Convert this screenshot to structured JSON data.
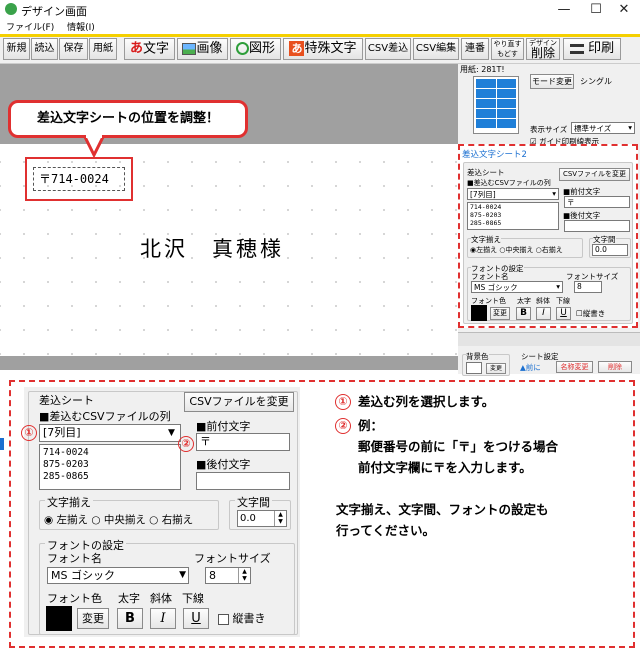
{
  "window": {
    "title": "デザイン画面",
    "minimize": "—",
    "maximize": "☐",
    "close": "✕"
  },
  "menu": [
    "ファイル(F)",
    "情報(I)"
  ],
  "toolbar": {
    "new": "新規",
    "open": "読込",
    "save": "保存",
    "paper": "用紙",
    "text": "文字",
    "image": "画像",
    "shape": "図形",
    "special_text": "特殊文字",
    "csv_insert": "CSV差込",
    "csv_edit": "CSV編集",
    "serial": "連番",
    "redo": "やり直す",
    "undo": "もどす",
    "design_delete_top": "デザイン",
    "design_delete": "削除",
    "print": "印刷"
  },
  "callout": "差込文字シートの位置を調整！",
  "canvas": {
    "zip": "〒714-0024",
    "name": "北沢　真穂様"
  },
  "right": {
    "paper_info": "用紙: 281T!",
    "mode_button": "モード変更",
    "mode_value": "シングル",
    "display_size_label": "表示サイズ",
    "display_size_value": "標準サイズ",
    "guide_checkbox": "ガイド印刷線表示",
    "sheet_title": "差込文字シート2",
    "sheet_label": "差込シート",
    "csv_file_button": "CSVファイルを変更",
    "column_label": "■差込むCSVファイルの列",
    "column_value": "[7列目]",
    "prefix_label": "■前付文字",
    "prefix_value": "〒",
    "suffix_label": "■後付文字",
    "list": [
      "714-0024",
      "875-0203",
      "285-0865"
    ],
    "align_label": "文字揃え",
    "align_left": "左揃え",
    "align_center": "中央揃え",
    "align_right": "右揃え",
    "spacing_label": "文字間",
    "spacing_value": "0.0",
    "font_settings": "フォントの設定",
    "font_name_label": "フォント名",
    "font_name_value": "MS ゴシック",
    "font_size_label": "フォントサイズ",
    "font_size_value": "8",
    "font_color_label": "フォント色",
    "bold_label": "太字",
    "italic_label": "斜体",
    "underline_label": "下線",
    "change_button": "変更",
    "bold_btn": "B",
    "italic_btn": "I",
    "underline_btn": "U",
    "vertical_label": "縦書き",
    "bg_label": "背景色",
    "bg_change": "変更",
    "sheet_settings": "シート設定",
    "prev": "▲前に",
    "rename": "名称変更",
    "delete": "削除"
  },
  "dialog": {
    "sheet_label": "差込シート",
    "csv_file_button": "CSVファイルを変更",
    "column_label": "■差込むCSVファイルの列",
    "column_value": "[7列目]",
    "prefix_label": "■前付文字",
    "prefix_value": "〒",
    "suffix_label": "■後付文字",
    "suffix_value": "",
    "list": [
      "714-0024",
      "875-0203",
      "285-0865"
    ],
    "align_label": "文字揃え",
    "align_left": "左揃え",
    "align_center": "中央揃え",
    "align_right": "右揃え",
    "spacing_label": "文字間",
    "spacing_value": "0.0",
    "font_settings": "フォントの設定",
    "font_name_label": "フォント名",
    "font_name_value": "MS ゴシック",
    "font_size_label": "フォントサイズ",
    "font_size_value": "8",
    "font_color_label": "フォント色",
    "bold_label": "太字",
    "italic_label": "斜体",
    "underline_label": "下線",
    "change_button": "変更",
    "bold_btn": "B",
    "italic_btn": "I",
    "underline_btn": "U",
    "vertical_label": "縦書き"
  },
  "markers": {
    "one": "①",
    "two": "②"
  },
  "instructions": {
    "step1": "差込む列を選択します。",
    "step2_title": "例：",
    "step2_line1": "郵便番号の前に「〒」をつける場合",
    "step2_line2": "前付文字欄に〒を入力します。",
    "note_line1": "文字揃え、文字間、フォントの設定も",
    "note_line2": "行ってください。"
  },
  "colors": {
    "accent_red": "#e03030",
    "toolbar_yellow": "#f5d000",
    "sheet_title_blue": "#1a6fd0"
  }
}
